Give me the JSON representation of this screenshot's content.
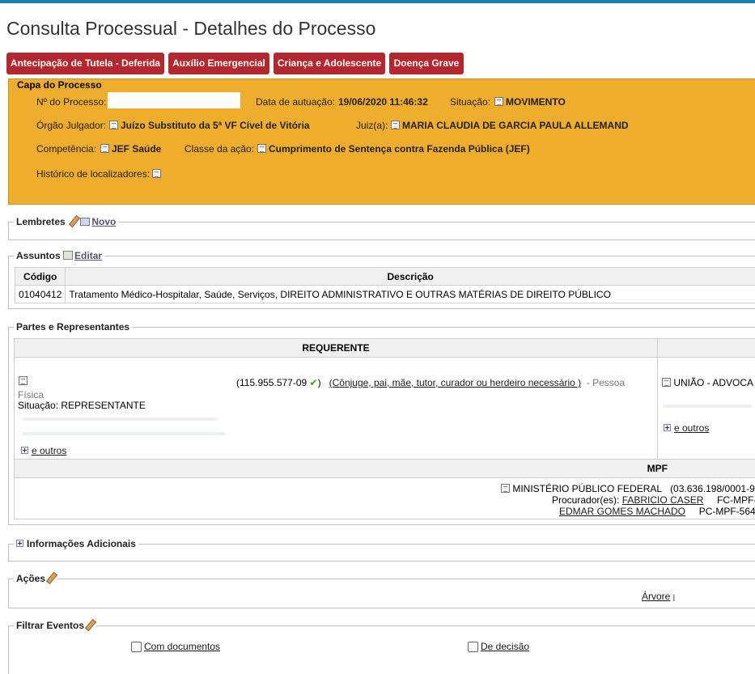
{
  "page": {
    "title": "Consulta Processual - Detalhes do Processo"
  },
  "tags": [
    "Antecipação de Tutela - Deferida",
    "Auxílio Emergencial",
    "Criança e Adolescente",
    "Doença Grave"
  ],
  "colors": {
    "tag_bg": "#b2282e",
    "capa_bg": "#efad2e",
    "top_bar": "#1a7fa8",
    "check": "#3a9a2a"
  },
  "capa": {
    "legend": "Capa do Processo",
    "numero_label": "Nº do Processo:",
    "numero_value": "",
    "data_label": "Data de autuação:",
    "data_value": "19/06/2020 11:46:32",
    "situacao_label": "Situação:",
    "situacao_value": "MOVIMENTO",
    "orgao_label": "Órgão Julgador:",
    "orgao_value": "Juízo Substituto da 5ª VF Cível de Vitória",
    "juiz_label": "Juiz(a):",
    "juiz_value": "MARIA CLAUDIA DE GARCIA PAULA ALLEMAND",
    "competencia_label": "Competência:",
    "competencia_value": "JEF Saúde",
    "classe_label": "Classe da ação:",
    "classe_value": "Cumprimento de Sentença contra Fazenda Pública (JEF)",
    "historico_label": "Histórico de localizadores:"
  },
  "lembretes": {
    "legend": "Lembretes",
    "novo": "Novo"
  },
  "assuntos": {
    "legend": "Assuntos",
    "editar": "Editar",
    "headers": [
      "Código",
      "Descrição"
    ],
    "rows": [
      {
        "codigo": "01040412",
        "descricao": "Tratamento Médico-Hospitalar, Saúde, Serviços, DIREITO ADMINISTRATIVO E OUTRAS MATÉRIAS DE DIREITO PÚBLICO"
      }
    ]
  },
  "partes": {
    "legend": "Partes e Representantes",
    "requerente_header": "REQUERENTE",
    "requerente_cpf": "(115.955.577-09",
    "requerente_cpf_close": ")",
    "requerente_relacao": "(Cônjuge, pai, mãe, tutor, curador ou herdeiro necessário )",
    "requerente_tipo": "- Pessoa",
    "requerente_tipo2": "Física",
    "requerente_situacao": "Situação: REPRESENTANTE",
    "requerente_outros": "e outros",
    "requerido_name": "UNIÃO - ADVOCA",
    "requerido_outros": "e outros",
    "mpf_header": "MPF",
    "mpf_name": "MINISTÉRIO PÚBLICO FEDERAL",
    "mpf_cnpj": "(03.636.198/0001-9",
    "procurador_label": "Procurador(es):",
    "procurador1": "FABRICIO CASER",
    "procurador1_code": "FC-MPF-",
    "procurador2": "EDMAR GOMES MACHADO",
    "procurador2_code": "PC-MPF-564"
  },
  "info_adicionais": {
    "legend": "Informações Adicionais"
  },
  "acoes": {
    "legend": "Ações",
    "arvore": "Árvore",
    "sep": "|"
  },
  "filtrar": {
    "legend": "Filtrar Eventos",
    "com_documentos": "Com documentos",
    "de_decisao": "De decisão"
  }
}
